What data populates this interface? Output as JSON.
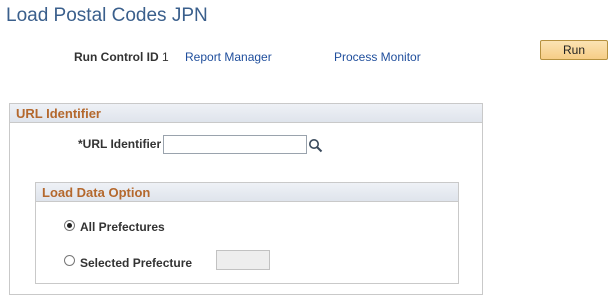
{
  "page": {
    "title": "Load Postal Codes JPN"
  },
  "run_control": {
    "label": "Run Control ID",
    "value": "1",
    "report_manager_link": "Report Manager",
    "process_monitor_link": "Process Monitor",
    "run_button": "Run"
  },
  "url_section": {
    "header": "URL Identifier",
    "field_label": "*URL Identifier",
    "field_value": "",
    "lookup_icon": "magnifier-icon"
  },
  "load_section": {
    "header": "Load Data Option",
    "options": [
      {
        "label": "All Prefectures",
        "checked": true
      },
      {
        "label": "Selected Prefecture",
        "checked": false
      }
    ],
    "prefecture_value": ""
  }
}
